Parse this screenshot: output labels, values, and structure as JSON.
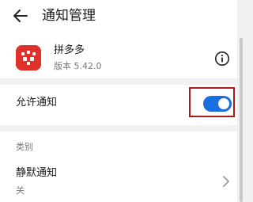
{
  "header": {
    "title": "通知管理",
    "back_icon": "arrow-left-icon"
  },
  "app": {
    "name": "拼多多",
    "version": "版本 5.42.0",
    "icon": "pinduoduo-app-icon",
    "icon_color": "#e0302a",
    "info_icon": "info-circle-icon"
  },
  "allow_notifications": {
    "label": "允许通知",
    "enabled": true,
    "accent": "#1a6fe0",
    "highlight_color": "#b11a1a"
  },
  "categories": {
    "section_label": "类别",
    "items": [
      {
        "title": "静默通知",
        "subtitle": "关",
        "icon": "chevron-right-icon"
      }
    ]
  }
}
